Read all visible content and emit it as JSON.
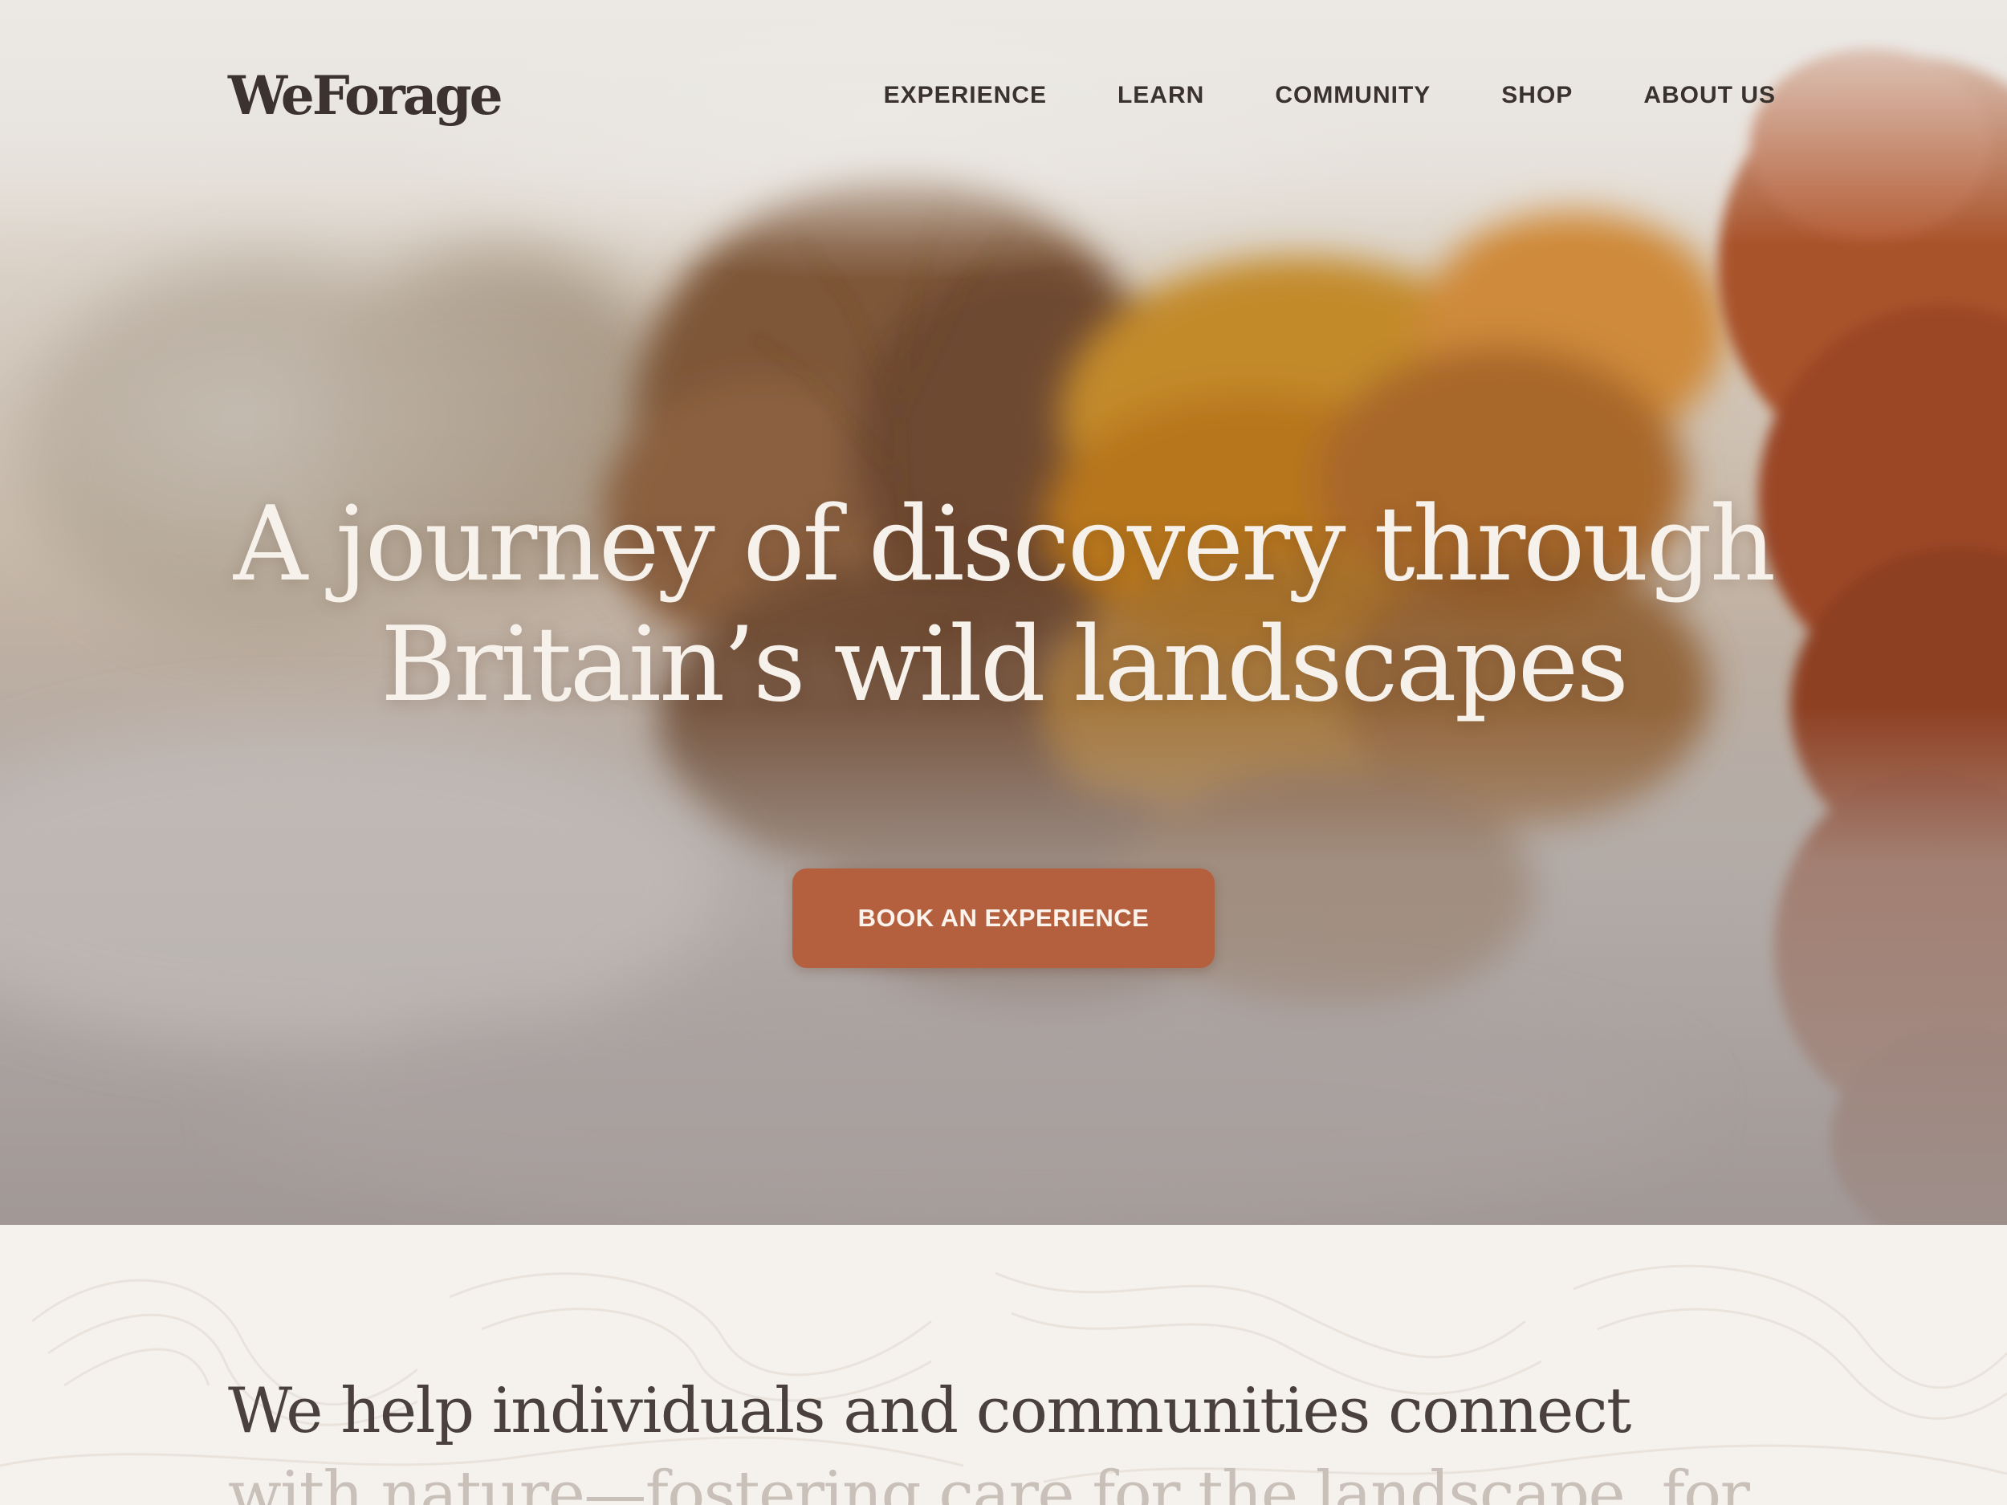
{
  "brand": {
    "logo_text": "WeForage"
  },
  "nav": {
    "items": [
      {
        "label": "EXPERIENCE"
      },
      {
        "label": "LEARN"
      },
      {
        "label": "COMMUNITY"
      },
      {
        "label": "SHOP"
      },
      {
        "label": "ABOUT US"
      }
    ]
  },
  "hero": {
    "headline_line1": "A journey of discovery through",
    "headline_line2": "Britain’s wild landscapes",
    "cta_label": "BOOK AN EXPERIENCE",
    "background_description": "misty autumn lake with orange trees reflected in water"
  },
  "intro": {
    "line1": "We help individuals and communities connect",
    "line2": "with nature—fostering care for the landscape, for"
  },
  "colors": {
    "accent": "#b4603f",
    "text_dark": "#3c322e",
    "headline": "#f6f1ea",
    "section_bg": "#f5f2ed"
  }
}
